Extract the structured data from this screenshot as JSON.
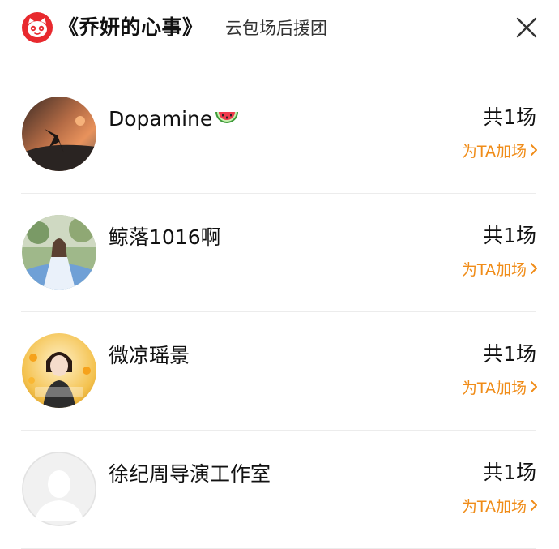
{
  "header": {
    "title": "《乔妍的心事》",
    "subtitle": "云包场后援团",
    "logo_icon": "maoyan-cat-logo-icon",
    "close_icon": "close-icon"
  },
  "colors": {
    "brand_red": "#e8292e",
    "link_orange": "#f08c18"
  },
  "supporters": [
    {
      "name": "Dopamine",
      "name_emoji": "watermelon",
      "count": "共1场",
      "add_label": "为TA加场"
    },
    {
      "name": "鲸落1016啊",
      "count": "共1场",
      "add_label": "为TA加场"
    },
    {
      "name": "微凉瑶景",
      "count": "共1场",
      "add_label": "为TA加场"
    },
    {
      "name": "徐纪周导演工作室",
      "count": "共1场",
      "add_label": "为TA加场"
    }
  ]
}
